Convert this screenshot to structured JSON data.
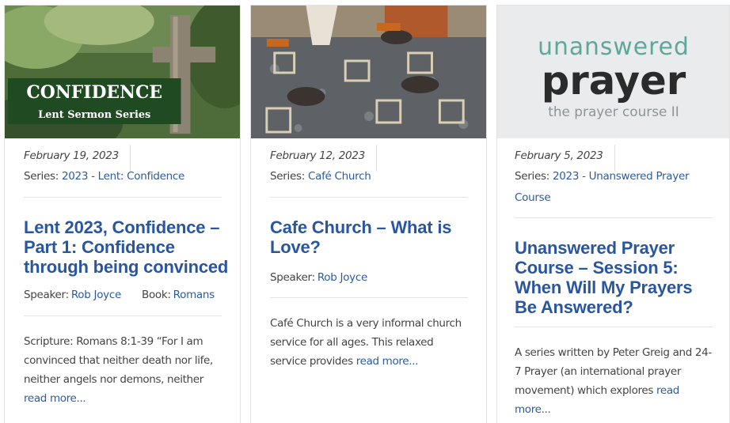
{
  "posts": [
    {
      "image": {
        "line1": "CONFIDENCE",
        "line2": "Lent Sermon Series"
      },
      "date": "February 19, 2023",
      "series_label": "Series:",
      "series_value": "2023 - Lent: Confidence",
      "title": "Lent 2023, Confidence – Part 1: Confidence through being convinced",
      "speaker_label": "Speaker:",
      "speaker": "Rob Joyce",
      "book_label": "Book:",
      "book": "Romans",
      "excerpt": "Scripture: Romans 8:1-39 “For I am convinced that neither death nor life, neither angels nor demons, neither",
      "read_more": "read more..."
    },
    {
      "date": "February 12, 2023",
      "series_label": "Series:",
      "series_value": "Café Church",
      "title": "Cafe Church – What is Love?",
      "speaker_label": "Speaker:",
      "speaker": "Rob Joyce",
      "excerpt": "Café Church is a very informal church service for all ages. This relaxed service provides",
      "read_more": "read more..."
    },
    {
      "image": {
        "line1": "unanswered",
        "line2": "prayer",
        "line3": "the prayer course II"
      },
      "date": "February 5, 2023",
      "series_label": "Series:",
      "series_value": "2023 - Unanswered Prayer Course",
      "title": "Unanswered Prayer Course – Session 5: When Will My Prayers Be Answered?",
      "excerpt": "A series written by Peter Greig and 24-7 Prayer (an international prayer movement) which explores",
      "read_more": "read more..."
    }
  ],
  "colors": {
    "link": "#2e5b9e",
    "title": "#2a56a0",
    "text": "#444444"
  }
}
